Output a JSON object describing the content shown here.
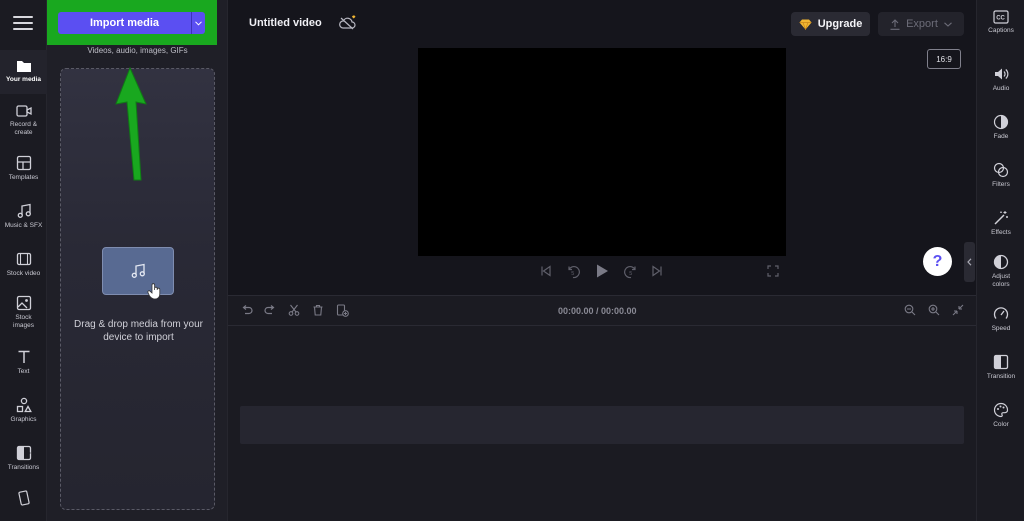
{
  "left_rail": {
    "menu_icon": "hamburger-icon",
    "items": [
      {
        "label": "Your media",
        "icon": "folder-icon"
      },
      {
        "label": "Record &\ncreate",
        "icon": "video-camera-icon"
      },
      {
        "label": "Templates",
        "icon": "templates-icon"
      },
      {
        "label": "Music & SFX",
        "icon": "music-note-icon"
      },
      {
        "label": "Stock video",
        "icon": "film-icon"
      },
      {
        "label": "Stock\nimages",
        "icon": "image-icon"
      },
      {
        "label": "Text",
        "icon": "text-icon"
      },
      {
        "label": "Graphics",
        "icon": "shapes-icon"
      },
      {
        "label": "Transitions",
        "icon": "transitions-icon"
      },
      {
        "label": "",
        "icon": "brand-kit-icon"
      }
    ]
  },
  "media_panel": {
    "import_label": "Import media",
    "import_hint": "Videos, audio, images, GIFs",
    "drop_text": "Drag & drop media from your device to import"
  },
  "top_bar": {
    "title": "Untitled video",
    "upgrade_label": "Upgrade",
    "export_label": "Export"
  },
  "preview": {
    "aspect_ratio": "16:9",
    "help_label": "?"
  },
  "timeline": {
    "timecode": "00:00.00 / 00:00.00"
  },
  "right_rail": {
    "items": [
      {
        "label": "Captions",
        "icon": "captions-icon"
      },
      {
        "label": "Audio",
        "icon": "speaker-icon"
      },
      {
        "label": "Fade",
        "icon": "fade-icon"
      },
      {
        "label": "Filters",
        "icon": "filters-icon"
      },
      {
        "label": "Effects",
        "icon": "magic-wand-icon"
      },
      {
        "label": "Adjust\ncolors",
        "icon": "contrast-icon"
      },
      {
        "label": "Speed",
        "icon": "speedometer-icon"
      },
      {
        "label": "Transition",
        "icon": "transition-icon"
      },
      {
        "label": "Color",
        "icon": "palette-icon"
      }
    ]
  },
  "colors": {
    "accent": "#5b4ff2",
    "annotation_green": "#19a81f",
    "background": "#15151c"
  }
}
